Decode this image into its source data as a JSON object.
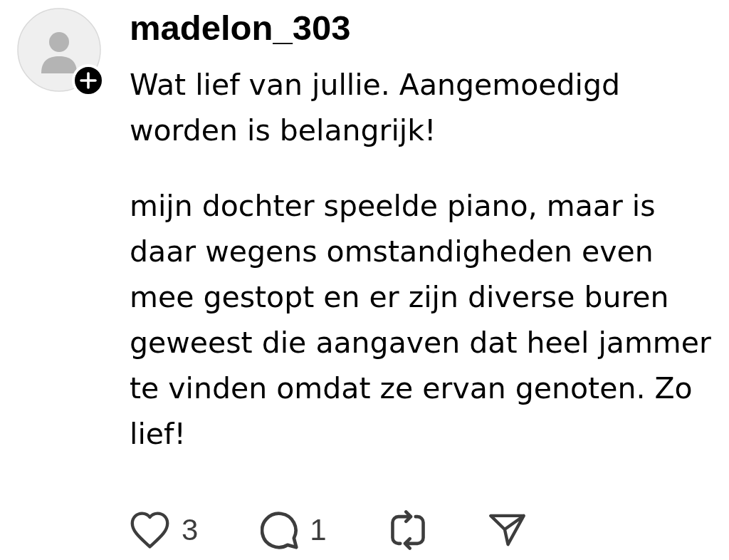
{
  "comment": {
    "username": "madelon_303",
    "paragraphs": [
      "Wat lief van jullie. Aangemoedigd worden is belangrijk!",
      "mijn dochter speelde piano, maar is daar wegens omstandigheden even mee gestopt en er zijn diverse buren geweest die aangaven dat heel jammer te vinden omdat ze ervan genoten. Zo lief!"
    ],
    "actions": [
      {
        "kind": "like",
        "count": "3"
      },
      {
        "kind": "reply",
        "count": "1"
      },
      {
        "kind": "repost"
      },
      {
        "kind": "share"
      }
    ]
  }
}
